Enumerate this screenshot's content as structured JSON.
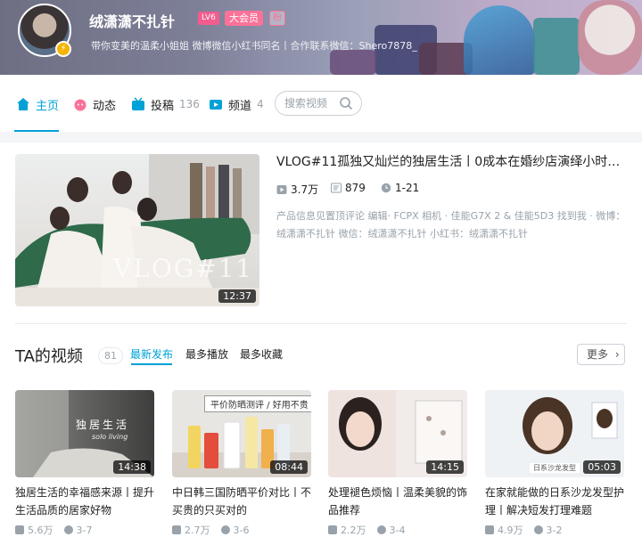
{
  "profile": {
    "username": "绒潇潇不扎针",
    "level": "LV6",
    "vip_label": "大会员",
    "fan_badge": "粉",
    "sign": "带你变美的温柔小姐姐 微博微信小红书同名丨合作联系微信：Shero7878_"
  },
  "nav": {
    "home": "主页",
    "dynamic": "动态",
    "submit": "投稿",
    "submit_count": "136",
    "channel": "频道",
    "channel_count": "4",
    "search_placeholder": "搜索视频"
  },
  "featured": {
    "title": "VLOG#11孤独又灿烂的独居生活丨0成本在婚纱店演绎小时代...",
    "thumb_text": "VLOG#11",
    "duration": "12:37",
    "plays": "3.7万",
    "danmaku": "879",
    "date": "1-21",
    "desc": "产品信息见置顶评论 编辑· FCPX 相机 · 佳能G7X 2 & 佳能5D3 找到我 · 微博：绒潇潇不扎针 微信：绒潇潇不扎针 小红书：绒潇潇不扎针"
  },
  "videos_section": {
    "title": "TA的视频",
    "count": "81",
    "tab_latest": "最新发布",
    "tab_most_played": "最多播放",
    "tab_most_fav": "最多收藏",
    "more": "更多"
  },
  "videos": [
    {
      "title": "独居生活的幸福感来源丨提升生活品质的居家好物",
      "duration": "14:38",
      "plays": "5.6万",
      "date": "3-7",
      "thumb_text": "独居生活"
    },
    {
      "title": "中日韩三国防晒平价对比丨不买贵的只买对的",
      "duration": "08:44",
      "plays": "2.7万",
      "date": "3-6",
      "thumb_text": "平价防晒测评 / 好用不贵"
    },
    {
      "title": "处理褪色烦恼丨温柔美貌的饰品推荐",
      "duration": "14:15",
      "plays": "2.2万",
      "date": "3-4",
      "thumb_text": ""
    },
    {
      "title": "在家就能做的日系沙龙发型护理丨解决短发打理难题",
      "duration": "05:03",
      "plays": "4.9万",
      "date": "3-2",
      "thumb_text": "日系沙龙发型"
    }
  ],
  "colors": {
    "accent": "#00a1d6",
    "pink": "#fb7299",
    "gray": "#99a2aa"
  }
}
